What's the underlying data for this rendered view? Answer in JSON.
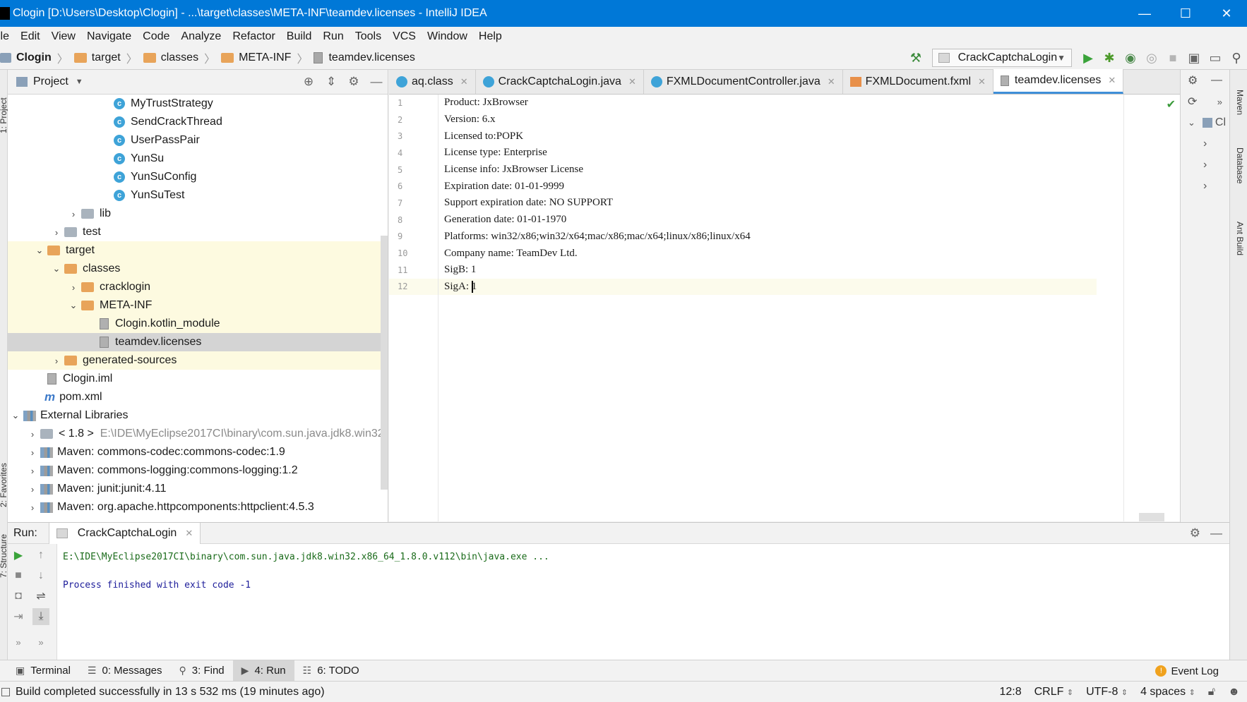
{
  "window": {
    "title": "Clogin [D:\\Users\\Desktop\\Clogin] - ...\\target\\classes\\META-INF\\teamdev.licenses - IntelliJ IDEA",
    "min_glyph": "—",
    "max_glyph": "☐",
    "close_glyph": "✕"
  },
  "menu": [
    "ile",
    "Edit",
    "View",
    "Navigate",
    "Code",
    "Analyze",
    "Refactor",
    "Build",
    "Run",
    "Tools",
    "VCS",
    "Window",
    "Help"
  ],
  "breadcrumb": [
    "Clogin",
    "target",
    "classes",
    "META-INF",
    "teamdev.licenses"
  ],
  "run_config": "CrackCaptchaLogin",
  "project_panel": {
    "title": "Project",
    "tree": [
      {
        "label": "MyTrustStrategy",
        "kind": "class"
      },
      {
        "label": "SendCrackThread",
        "kind": "class"
      },
      {
        "label": "UserPassPair",
        "kind": "class"
      },
      {
        "label": "YunSu",
        "kind": "class"
      },
      {
        "label": "YunSuConfig",
        "kind": "class"
      },
      {
        "label": "YunSuTest",
        "kind": "class"
      },
      {
        "label": "lib",
        "kind": "folder"
      },
      {
        "label": "test",
        "kind": "folder"
      },
      {
        "label": "target",
        "kind": "folder"
      },
      {
        "label": "classes",
        "kind": "folder"
      },
      {
        "label": "cracklogin",
        "kind": "folder"
      },
      {
        "label": "META-INF",
        "kind": "folder"
      },
      {
        "label": "Clogin.kotlin_module",
        "kind": "file"
      },
      {
        "label": "teamdev.licenses",
        "kind": "file"
      },
      {
        "label": "generated-sources",
        "kind": "folder"
      },
      {
        "label": "Clogin.iml",
        "kind": "file"
      },
      {
        "label": "pom.xml",
        "kind": "maven"
      },
      {
        "label": "External Libraries",
        "kind": "libs"
      },
      {
        "label": "< 1.8 >",
        "kind": "jdk",
        "detail": "E:\\IDE\\MyEclipse2017CI\\binary\\com.sun.java.jdk8.win32."
      },
      {
        "label": "Maven: commons-codec:commons-codec:1.9",
        "kind": "lib"
      },
      {
        "label": "Maven: commons-logging:commons-logging:1.2",
        "kind": "lib"
      },
      {
        "label": "Maven: junit:junit:4.11",
        "kind": "lib"
      },
      {
        "label": "Maven: org.apache.httpcomponents:httpclient:4.5.3",
        "kind": "lib"
      }
    ]
  },
  "tabs": [
    "aq.class",
    "CrackCaptchaLogin.java",
    "FXMLDocumentController.java",
    "FXMLDocument.fxml",
    "teamdev.licenses"
  ],
  "editor": {
    "lines": [
      "Product: JxBrowser",
      "Version: 6.x",
      "Licensed to:POPK",
      "License type: Enterprise",
      "License info: JxBrowser License",
      "Expiration date: 01-01-9999",
      "Support expiration date: NO SUPPORT",
      "Generation date: 01-01-1970",
      "Platforms: win32/x86;win32/x64;mac/x86;mac/x64;linux/x86;linux/x64",
      "Company name: TeamDev Ltd.",
      "SigB: 1",
      "SigA: 1"
    ],
    "line_numbers": [
      "1",
      "2",
      "3",
      "4",
      "5",
      "6",
      "7",
      "8",
      "9",
      "10",
      "11",
      "12"
    ]
  },
  "right_panel": {
    "label": "Cl"
  },
  "right_stripe": [
    "Maven",
    "Database",
    "Ant Build"
  ],
  "left_stripe": [
    "1: Project",
    "2: Favorites",
    "7: Structure"
  ],
  "run_panel": {
    "label": "Run:",
    "tab": "CrackCaptchaLogin",
    "console": [
      "E:\\IDE\\MyEclipse2017CI\\binary\\com.sun.java.jdk8.win32.x86_64_1.8.0.v112\\bin\\java.exe ...",
      "Process finished with exit code -1"
    ]
  },
  "tool_tabs": [
    "Terminal",
    "0: Messages",
    "3: Find",
    "4: Run",
    "6: TODO"
  ],
  "event_log": "Event Log",
  "status": {
    "message": "Build completed successfully in 13 s 532 ms (19 minutes ago)",
    "position": "12:8",
    "line_sep": "CRLF",
    "encoding": "UTF-8",
    "indent": "4 spaces"
  },
  "colors": {
    "accent": "#0078d7",
    "tab_underline": "#3f8fd8",
    "highlight_row": "#fdfae0"
  }
}
